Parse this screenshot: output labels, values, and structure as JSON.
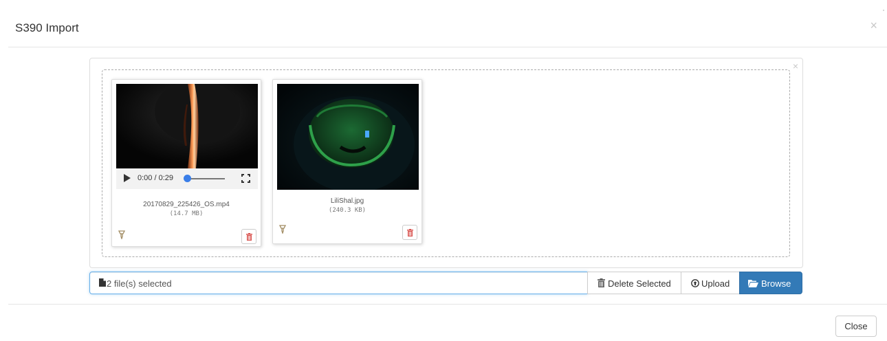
{
  "modal": {
    "title": "S390 Import",
    "close_symbol": "×"
  },
  "preview": {
    "close_symbol": "×",
    "files": [
      {
        "type": "video",
        "name": "20170829_225426_OS.mp4",
        "size": "(14.7 MB)",
        "player": {
          "time": "0:00 / 0:29",
          "progress": 0.0
        }
      },
      {
        "type": "image",
        "name": "LiliShal.jpg",
        "size": "(240.3 KB)"
      }
    ],
    "icons": {
      "drag": "drag-handle-icon",
      "delete": "trash-icon"
    }
  },
  "input": {
    "caption": "2 file(s) selected",
    "buttons": {
      "delete_selected": "Delete Selected",
      "upload": "Upload",
      "browse": "Browse"
    }
  },
  "footer": {
    "close_label": "Close"
  },
  "colors": {
    "primary": "#337ab7",
    "focus": "#66afe9",
    "seek": "#3a7ee8",
    "danger": "#d9534f"
  }
}
